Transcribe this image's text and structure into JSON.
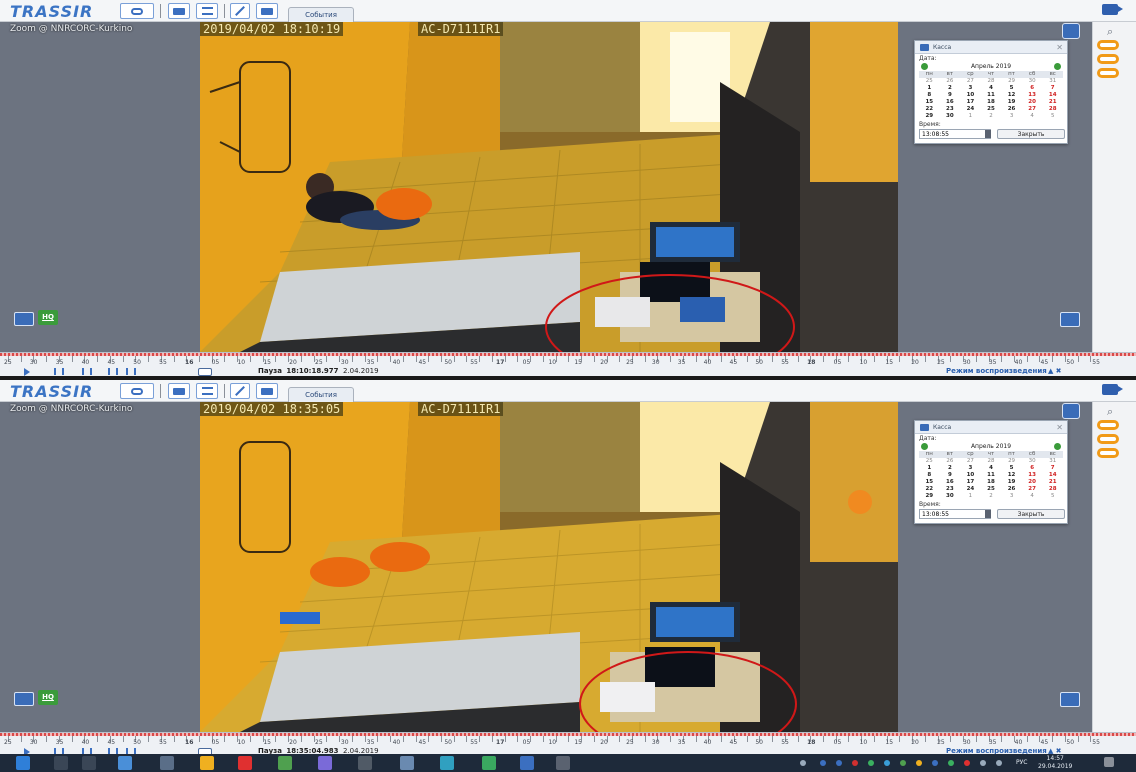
{
  "app": {
    "logo_text": "TRASSIR",
    "events_tab": "События"
  },
  "panes": [
    {
      "camera_label": "Zoom @ NNRCORC-Kurkino",
      "osd_datetime": "2019/04/02 18:10:19",
      "osd_camera": "AC-D7111IR1",
      "hq_label": "HQ",
      "timeline_numbers": [
        "25",
        "30",
        "35",
        "40",
        "45",
        "50",
        "55",
        "16",
        "05",
        "10",
        "15",
        "20",
        "25",
        "30",
        "35",
        "40",
        "45",
        "50",
        "55",
        "17",
        "05",
        "10",
        "15",
        "20",
        "25",
        "30",
        "35",
        "40",
        "45",
        "50",
        "55",
        "18",
        "05",
        "10",
        "15",
        "20",
        "25",
        "30",
        "35",
        "40",
        "45",
        "50",
        "55"
      ],
      "playback_status": "Пауза",
      "playback_time": "18:10:18.977",
      "playback_date": "2.04.2019",
      "mode_label": "Режим воспроизведения"
    },
    {
      "camera_label": "Zoom @ NNRCORC-Kurkino",
      "osd_datetime": "2019/04/02 18:35:05",
      "osd_camera": "AC-D7111IR1",
      "hq_label": "HQ",
      "timeline_numbers": [
        "25",
        "30",
        "35",
        "40",
        "45",
        "50",
        "55",
        "16",
        "05",
        "10",
        "15",
        "20",
        "25",
        "30",
        "35",
        "40",
        "45",
        "50",
        "55",
        "17",
        "05",
        "10",
        "15",
        "20",
        "25",
        "30",
        "35",
        "40",
        "45",
        "50",
        "55",
        "18",
        "05",
        "10",
        "15",
        "20",
        "25",
        "30",
        "35",
        "40",
        "45",
        "50",
        "55"
      ],
      "playback_status": "Пауза",
      "playback_time": "18:35:04.983",
      "playback_date": "2.04.2019",
      "mode_label": "Режим воспроизведения"
    }
  ],
  "calendar": {
    "title": "Касса",
    "date_label": "Дата:",
    "month": "Апрель",
    "year": "2019",
    "weekdays": [
      "пн",
      "вт",
      "ср",
      "чт",
      "пт",
      "сб",
      "вс"
    ],
    "days": [
      [
        "25",
        "26",
        "27",
        "28",
        "29",
        "30",
        "31"
      ],
      [
        "1",
        "2",
        "3",
        "4",
        "5",
        "6",
        "7"
      ],
      [
        "8",
        "9",
        "10",
        "11",
        "12",
        "13",
        "14"
      ],
      [
        "15",
        "16",
        "17",
        "18",
        "19",
        "20",
        "21"
      ],
      [
        "22",
        "23",
        "24",
        "25",
        "26",
        "27",
        "28"
      ],
      [
        "29",
        "30",
        "1",
        "2",
        "3",
        "4",
        "5"
      ]
    ],
    "time_label": "Время:",
    "time_value": "13:08:55",
    "close_label": "Закрыть"
  },
  "taskbar": {
    "language": "РУС",
    "clock_time": "14:57",
    "clock_date": "29.04.2019"
  },
  "colors": {
    "accent": "#3b6fc0",
    "logo_red": "#d52b2b",
    "orange": "#f19a17",
    "annotation": "#d01818"
  }
}
